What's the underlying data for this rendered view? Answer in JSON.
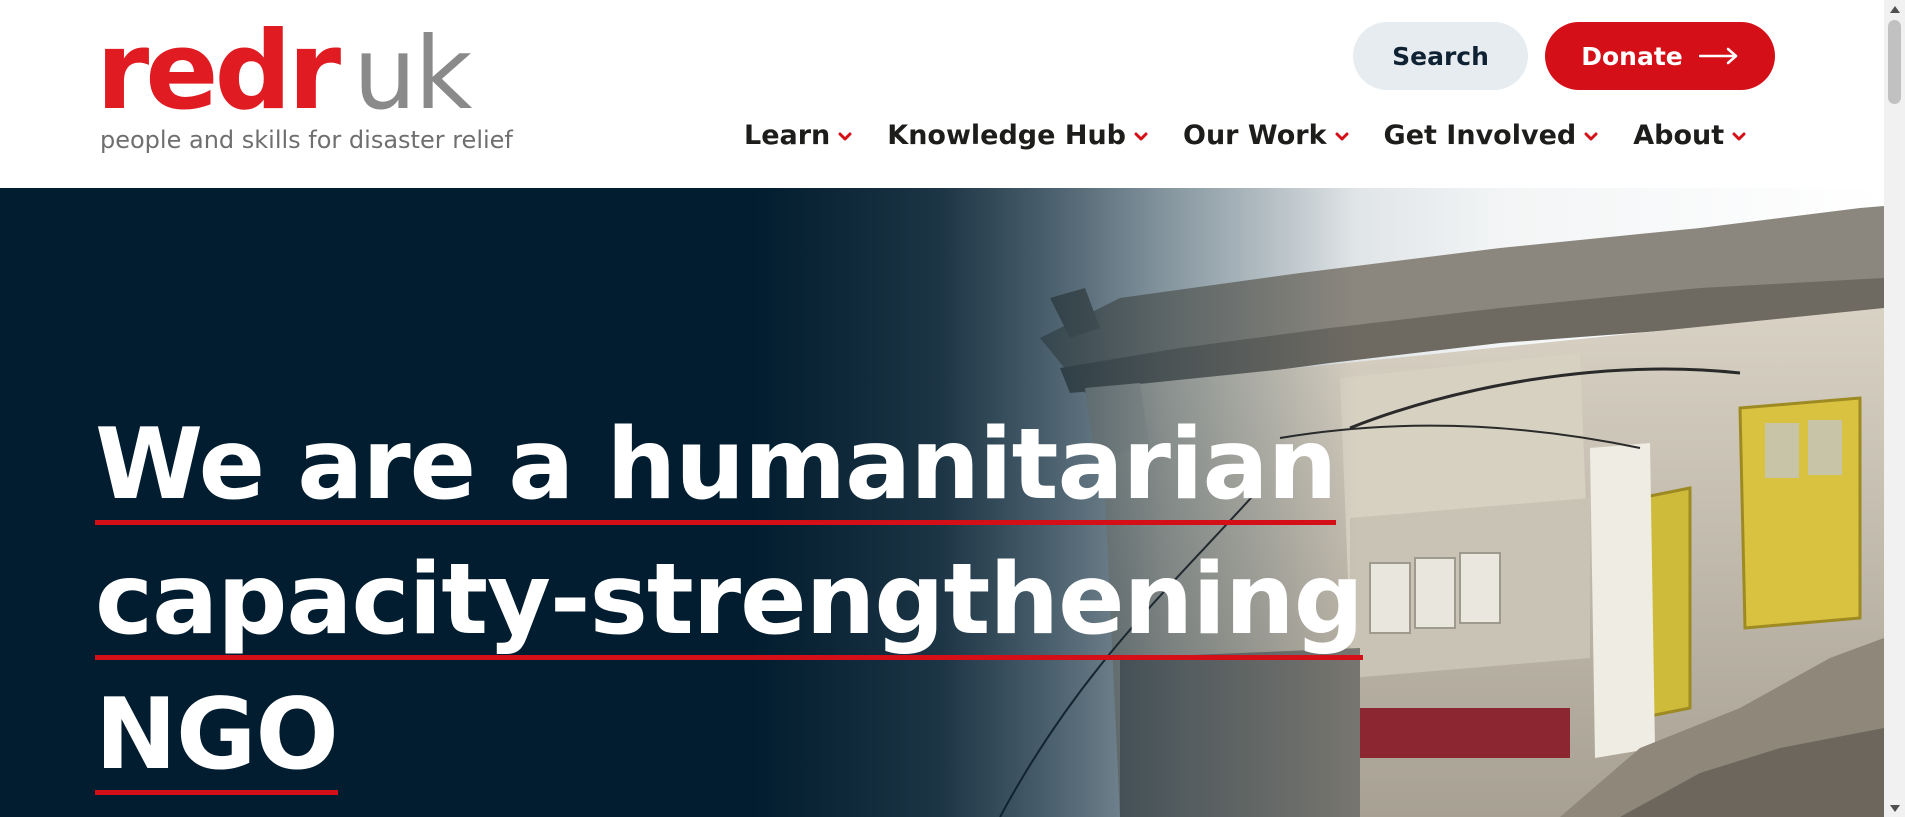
{
  "logo": {
    "brand": "redr",
    "suffix": "uk",
    "tagline": "people and skills for disaster relief"
  },
  "header": {
    "search_label": "Search",
    "donate_label": "Donate",
    "donate_icon": "arrow-right-icon"
  },
  "nav": {
    "items": [
      {
        "label": "Learn",
        "icon": "chevron-down-icon"
      },
      {
        "label": "Knowledge Hub",
        "icon": "chevron-down-icon"
      },
      {
        "label": "Our Work",
        "icon": "chevron-down-icon"
      },
      {
        "label": "Get Involved",
        "icon": "chevron-down-icon"
      },
      {
        "label": "About",
        "icon": "chevron-down-icon"
      }
    ]
  },
  "hero": {
    "lines": [
      "We are a humanitarian",
      "capacity-strengthening",
      "NGO"
    ],
    "image_subject": "collapsed-building-photo"
  },
  "colors": {
    "brand_red": "#d40f17",
    "logo_red": "#e01b22",
    "navy": "#021d2f",
    "search_bg": "#e6ecef"
  }
}
